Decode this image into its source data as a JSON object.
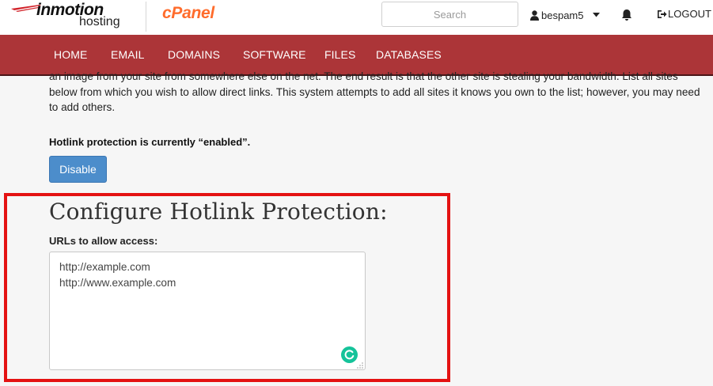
{
  "header": {
    "brand_name": "inmotion",
    "brand_sub": "hosting",
    "cpanel_logo": "cPanel",
    "search": {
      "placeholder": "Search",
      "value": ""
    },
    "user": {
      "name": "bespam5",
      "icon": "user-icon",
      "menu_icon": "caret-down-icon"
    },
    "notifications_icon": "bell-icon",
    "logout_label": "LOGOUT"
  },
  "nav": {
    "items": [
      {
        "label": "HOME"
      },
      {
        "label": "EMAIL"
      },
      {
        "label": "DOMAINS"
      },
      {
        "label": "SOFTWARE"
      },
      {
        "label": "FILES"
      },
      {
        "label": "DATABASES"
      }
    ]
  },
  "content": {
    "intro_paragraph": "an image from your site from somewhere else on the net. The end result is that the other site is stealing your bandwidth. List all sites below from which you wish to allow direct links. This system attempts to add all sites it knows you own to the list; however, you may need to add others.",
    "status_text": "Hotlink protection is currently “enabled”.",
    "disable_button": "Disable",
    "config_heading": "Configure Hotlink Protection:",
    "urls_label": "URLs to allow access:",
    "urls_value": "http://example.com\nhttp://www.example.com"
  },
  "colors": {
    "nav_bg": "#ac3538",
    "button_blue": "#4c8dcb",
    "highlight_red": "#e41212",
    "cpanel_orange": "#ff6c2c",
    "grammarly_green": "#15c39a"
  }
}
